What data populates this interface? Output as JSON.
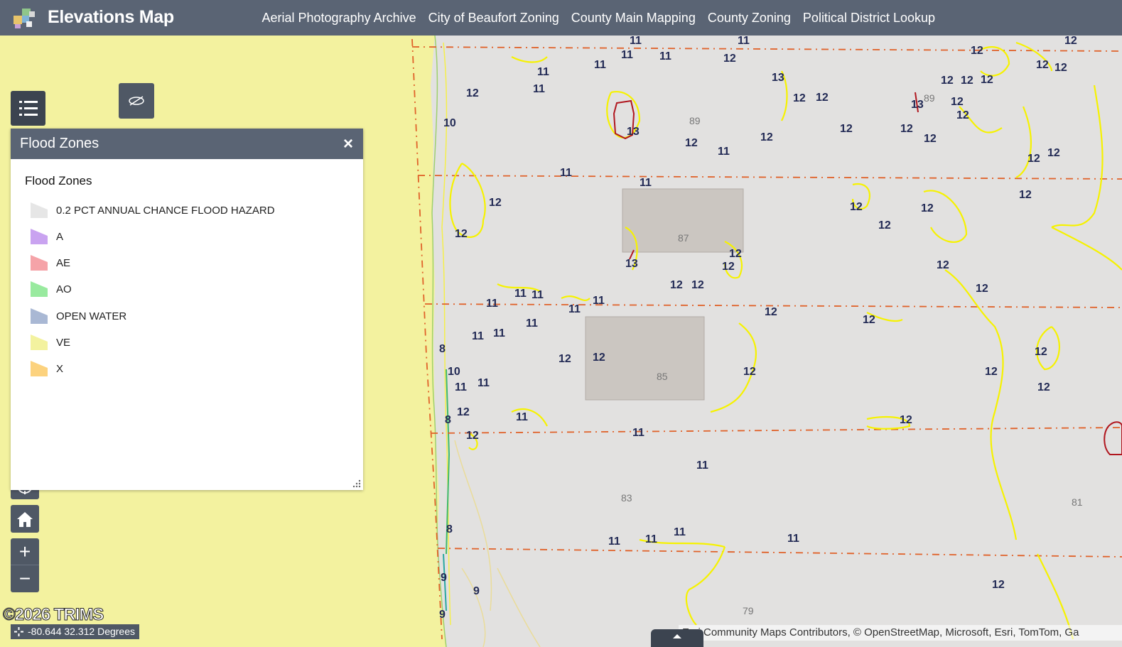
{
  "header": {
    "title": "Elevations Map",
    "nav": [
      "Aerial Photography Archive",
      "City of Beaufort Zoning",
      "County Main Mapping",
      "County Zoning",
      "Political District Lookup"
    ]
  },
  "panel": {
    "title": "Flood Zones",
    "close": "×",
    "heading": "Flood Zones",
    "legend": [
      {
        "label": "0.2 PCT ANNUAL CHANCE FLOOD HAZARD",
        "color": "#e6e6e6"
      },
      {
        "label": "A",
        "color": "#c9a3f0"
      },
      {
        "label": "AE",
        "color": "#f5a3a8"
      },
      {
        "label": "AO",
        "color": "#99ea9f"
      },
      {
        "label": "OPEN WATER",
        "color": "#a9b8d4"
      },
      {
        "label": "VE",
        "color": "#f3f29f"
      },
      {
        "label": "X",
        "color": "#fcd27e"
      }
    ]
  },
  "map": {
    "parcel_numbers": [
      "89",
      "87",
      "85",
      "83",
      "81",
      "79",
      "89"
    ],
    "contour_labels": [
      "12",
      "11",
      "13",
      "10",
      "8",
      "9"
    ]
  },
  "controls": {
    "zoom_in": "+",
    "zoom_out": "−"
  },
  "footer": {
    "copyright": "©2026 TRIMS",
    "coordinates": "-80.644 32.312 Degrees",
    "attribution": "Esri Community Maps Contributors, © OpenStreetMap, Microsoft, Esri, TomTom, Ga"
  },
  "colors": {
    "header": "#5a6474",
    "ve_zone": "#f3f29f",
    "shaded_zone": "#e6e6e6",
    "contour": "#f6f200",
    "parcel_line": "#e0622a"
  }
}
